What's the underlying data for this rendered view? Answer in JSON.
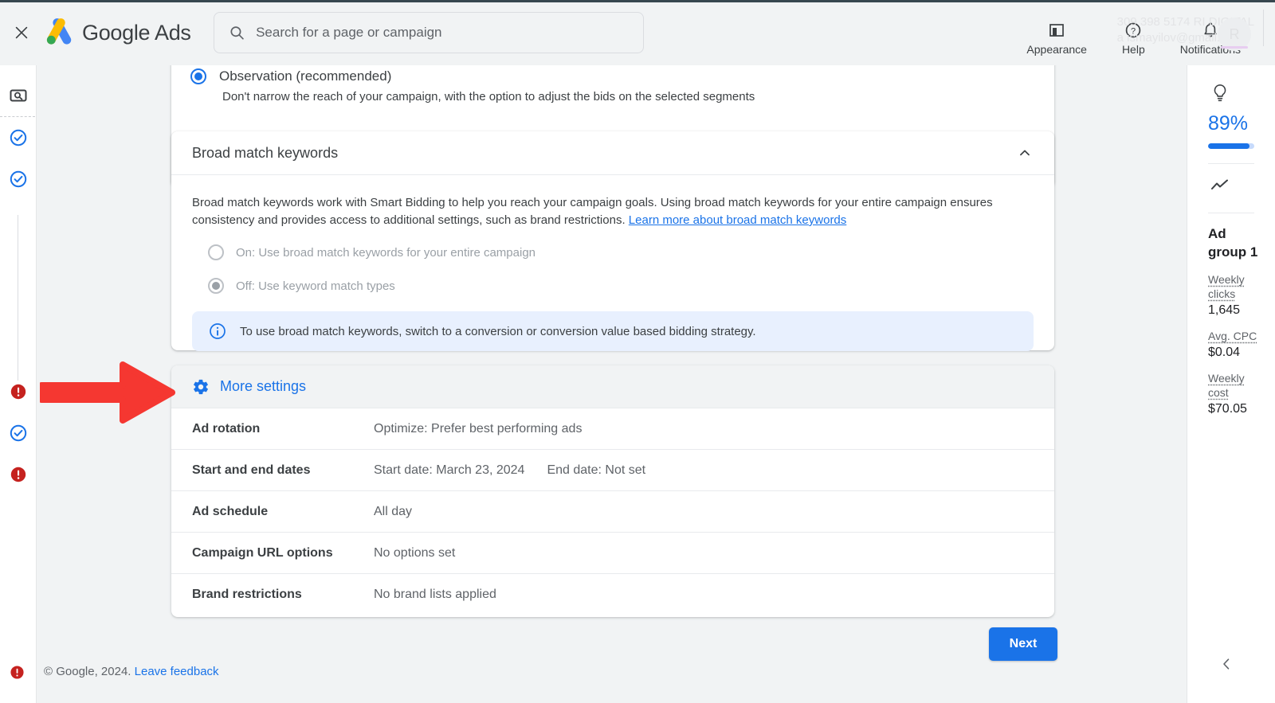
{
  "topbar": {
    "close_label": "Close",
    "brand_google": "Google",
    "brand_ads": "Ads",
    "search_placeholder": "Search for a page or campaign",
    "search_value": "",
    "items": [
      {
        "label": "Appearance",
        "icon": "appearance-icon"
      },
      {
        "label": "Help",
        "icon": "help-icon"
      },
      {
        "label": "Notifications",
        "icon": "bell-icon"
      }
    ],
    "ghost_account_line1": "309 398 5174 RI DIGITAL",
    "ghost_account_line2": "a  ismayilov@gmail.com",
    "ghost_avatar_letter": "R"
  },
  "leftrail": {
    "items": [
      {
        "icon": "keyword-planner-icon",
        "state": "neutral"
      },
      {
        "icon": "check-circle-icon",
        "state": "complete"
      },
      {
        "icon": "check-circle-icon",
        "state": "complete"
      },
      {
        "icon": "error-circle-icon",
        "state": "error"
      },
      {
        "icon": "check-circle-icon",
        "state": "complete"
      },
      {
        "icon": "error-circle-icon",
        "state": "error"
      },
      {
        "icon": "error-circle-icon",
        "state": "error"
      }
    ]
  },
  "observation_card": {
    "title": "Observation (recommended)",
    "subtitle": "Don't narrow the reach of your campaign, with the option to adjust the bids on the selected segments",
    "selected": true
  },
  "broad_match": {
    "title": "Broad match keywords",
    "collapse_icon": "chevron-up-icon",
    "description": "Broad match keywords work with Smart Bidding to help you reach your campaign goals. Using broad match keywords for your entire campaign ensures consistency and provides access to additional settings, such as brand restrictions.",
    "learn_more": "Learn more about broad match keywords",
    "options": [
      {
        "label": "On: Use broad match keywords for your entire campaign",
        "selected": false,
        "disabled": true
      },
      {
        "label": "Off: Use keyword match types",
        "selected": true,
        "disabled": true
      }
    ],
    "info_text": "To use broad match keywords, switch to a conversion or conversion value based bidding strategy.",
    "info_icon": "info-icon"
  },
  "more_settings": {
    "header_label": "More settings",
    "header_icon": "gear-icon",
    "rows": [
      {
        "label": "Ad rotation",
        "value": "Optimize: Prefer best performing ads",
        "value2": ""
      },
      {
        "label": "Start and end dates",
        "value": "Start date: March 23, 2024",
        "value2": "End date: Not set"
      },
      {
        "label": "Ad schedule",
        "value": "All day",
        "value2": ""
      },
      {
        "label": "Campaign URL options",
        "value": "No options set",
        "value2": ""
      },
      {
        "label": "Brand restrictions",
        "value": "No brand lists applied",
        "value2": ""
      }
    ]
  },
  "actions": {
    "next_label": "Next"
  },
  "footer": {
    "copyright": "© Google, 2024.",
    "feedback_link": "Leave feedback"
  },
  "right_panel": {
    "bulb_icon": "lightbulb-icon",
    "optimization_score": "89%",
    "progress_percent": 89,
    "trend_icon": "trending-up-icon",
    "group_name": "Ad group 1",
    "metrics": [
      {
        "label": "Weekly clicks",
        "value": "1,645"
      },
      {
        "label": "Avg. CPC",
        "value": "$0.04"
      },
      {
        "label": "Weekly cost",
        "value": "$70.05"
      }
    ],
    "collapse_icon": "chevron-left-icon"
  },
  "annotation": {
    "type": "red-arrow",
    "points_to": "More settings",
    "color": "#f53731"
  },
  "colors": {
    "accent_blue": "#1a73e8",
    "error_red": "#c5221f",
    "annotation_red": "#f53731",
    "page_bg": "#f1f3f4",
    "card_bg": "#ffffff",
    "info_bg": "#e8f0fe",
    "text_primary": "#3c4043",
    "text_secondary": "#5f6368"
  }
}
